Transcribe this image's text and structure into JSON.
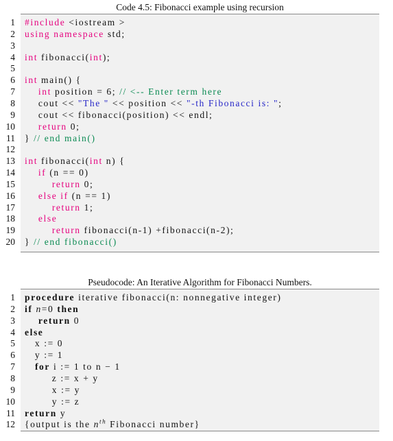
{
  "listing1": {
    "caption": "Code 4.5: Fibonacci example using recursion",
    "lines": [
      {
        "n": "1",
        "parts": [
          {
            "t": "#include",
            "c": "kw"
          },
          {
            "t": " <iostream >",
            "c": ""
          }
        ]
      },
      {
        "n": "2",
        "parts": [
          {
            "t": "using namespace",
            "c": "kw"
          },
          {
            "t": " std;",
            "c": ""
          }
        ]
      },
      {
        "n": "3",
        "parts": []
      },
      {
        "n": "4",
        "parts": [
          {
            "t": "int",
            "c": "kw"
          },
          {
            "t": " fibonacci(",
            "c": ""
          },
          {
            "t": "int",
            "c": "kw"
          },
          {
            "t": ");",
            "c": ""
          }
        ]
      },
      {
        "n": "5",
        "parts": []
      },
      {
        "n": "6",
        "parts": [
          {
            "t": "int",
            "c": "kw"
          },
          {
            "t": " main() {",
            "c": ""
          }
        ]
      },
      {
        "n": "7",
        "parts": [
          {
            "t": "    ",
            "c": ""
          },
          {
            "t": "int",
            "c": "kw"
          },
          {
            "t": " position = 6; ",
            "c": ""
          },
          {
            "t": "// <-- Enter term here",
            "c": "cm"
          }
        ]
      },
      {
        "n": "8",
        "parts": [
          {
            "t": "    cout << ",
            "c": ""
          },
          {
            "t": "\"The \"",
            "c": "str"
          },
          {
            "t": " << position << ",
            "c": ""
          },
          {
            "t": "\"-th Fibonacci is: \"",
            "c": "str"
          },
          {
            "t": ";",
            "c": ""
          }
        ]
      },
      {
        "n": "9",
        "parts": [
          {
            "t": "    cout << fibonacci(position) << endl;",
            "c": ""
          }
        ]
      },
      {
        "n": "10",
        "parts": [
          {
            "t": "    ",
            "c": ""
          },
          {
            "t": "return",
            "c": "kw"
          },
          {
            "t": " 0;",
            "c": ""
          }
        ]
      },
      {
        "n": "11",
        "parts": [
          {
            "t": "} ",
            "c": ""
          },
          {
            "t": "// end main()",
            "c": "cm"
          }
        ]
      },
      {
        "n": "12",
        "parts": []
      },
      {
        "n": "13",
        "parts": [
          {
            "t": "int",
            "c": "kw"
          },
          {
            "t": " fibonacci(",
            "c": ""
          },
          {
            "t": "int",
            "c": "kw"
          },
          {
            "t": " n) {",
            "c": ""
          }
        ]
      },
      {
        "n": "14",
        "parts": [
          {
            "t": "    ",
            "c": ""
          },
          {
            "t": "if",
            "c": "kw"
          },
          {
            "t": " (n == 0)",
            "c": ""
          }
        ]
      },
      {
        "n": "15",
        "parts": [
          {
            "t": "        ",
            "c": ""
          },
          {
            "t": "return",
            "c": "kw"
          },
          {
            "t": " 0;",
            "c": ""
          }
        ]
      },
      {
        "n": "16",
        "parts": [
          {
            "t": "    ",
            "c": ""
          },
          {
            "t": "else if",
            "c": "kw"
          },
          {
            "t": " (n == 1)",
            "c": ""
          }
        ]
      },
      {
        "n": "17",
        "parts": [
          {
            "t": "        ",
            "c": ""
          },
          {
            "t": "return",
            "c": "kw"
          },
          {
            "t": " 1;",
            "c": ""
          }
        ]
      },
      {
        "n": "18",
        "parts": [
          {
            "t": "    ",
            "c": ""
          },
          {
            "t": "else",
            "c": "kw"
          }
        ]
      },
      {
        "n": "19",
        "parts": [
          {
            "t": "        ",
            "c": ""
          },
          {
            "t": "return",
            "c": "kw"
          },
          {
            "t": " fibonacci(n-1) +fibonacci(n-2);",
            "c": ""
          }
        ]
      },
      {
        "n": "20",
        "parts": [
          {
            "t": "} ",
            "c": ""
          },
          {
            "t": "// end fibonacci()",
            "c": "cm"
          }
        ]
      }
    ]
  },
  "listing2": {
    "caption": "Pseudocode: An Iterative Algorithm for Fibonacci Numbers.",
    "lines": [
      {
        "n": "1",
        "parts": [
          {
            "t": "procedure",
            "c": "b"
          },
          {
            "t": " iterative fibonacci(n: nonnegative integer)",
            "c": ""
          }
        ]
      },
      {
        "n": "2",
        "parts": [
          {
            "t": "if",
            "c": "b"
          },
          {
            "t": " ",
            "c": ""
          },
          {
            "t": "n",
            "c": "it"
          },
          {
            "t": "=0 ",
            "c": ""
          },
          {
            "t": "then",
            "c": "b"
          }
        ]
      },
      {
        "n": "3",
        "parts": [
          {
            "t": "    ",
            "c": ""
          },
          {
            "t": "return",
            "c": "b"
          },
          {
            "t": " 0",
            "c": ""
          }
        ]
      },
      {
        "n": "4",
        "parts": [
          {
            "t": "else",
            "c": "b"
          }
        ]
      },
      {
        "n": "5",
        "parts": [
          {
            "t": "   x := 0",
            "c": ""
          }
        ]
      },
      {
        "n": "6",
        "parts": [
          {
            "t": "   y := 1",
            "c": ""
          }
        ]
      },
      {
        "n": "7",
        "parts": [
          {
            "t": "   ",
            "c": ""
          },
          {
            "t": "for",
            "c": "b"
          },
          {
            "t": " i := 1 to n − 1",
            "c": ""
          }
        ]
      },
      {
        "n": "8",
        "parts": [
          {
            "t": "        z := x + y",
            "c": ""
          }
        ]
      },
      {
        "n": "9",
        "parts": [
          {
            "t": "        x := y",
            "c": ""
          }
        ]
      },
      {
        "n": "10",
        "parts": [
          {
            "t": "        y := z",
            "c": ""
          }
        ]
      },
      {
        "n": "11",
        "parts": [
          {
            "t": "return",
            "c": "b"
          },
          {
            "t": " y",
            "c": ""
          }
        ]
      },
      {
        "n": "12",
        "parts": [
          {
            "t": "{output is the ",
            "c": ""
          },
          {
            "t": "n",
            "c": "it"
          },
          {
            "t": "th",
            "c": "sup"
          },
          {
            "t": " Fibonacci number}",
            "c": ""
          }
        ]
      }
    ]
  }
}
